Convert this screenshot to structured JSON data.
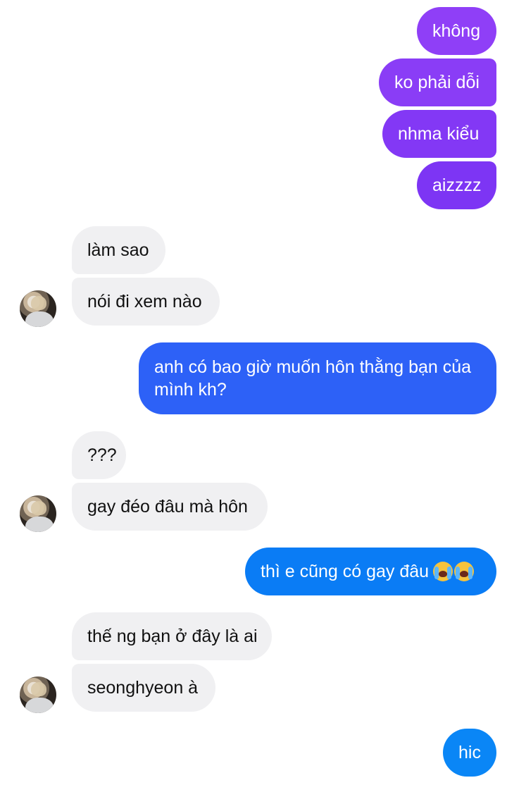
{
  "conversation": {
    "messages": [
      {
        "side": "out",
        "text": "không"
      },
      {
        "side": "out",
        "text": "ko phải dỗi"
      },
      {
        "side": "out",
        "text": "nhma kiểu"
      },
      {
        "side": "out",
        "text": "aizzzz"
      },
      {
        "side": "in",
        "text": "làm sao"
      },
      {
        "side": "in",
        "text": "nói đi xem nào"
      },
      {
        "side": "out",
        "text": "anh có bao giờ muốn hôn thằng bạn của mình kh?"
      },
      {
        "side": "in",
        "text": "???"
      },
      {
        "side": "in",
        "text": "gay đéo đâu mà hôn"
      },
      {
        "side": "out",
        "text": "thì e cũng có gay đâu"
      },
      {
        "side": "in",
        "text": "thế ng bạn ở đây là ai"
      },
      {
        "side": "in",
        "text": "seonghyeon à"
      },
      {
        "side": "out",
        "text": "hic"
      }
    ],
    "emoji": "😭😭"
  },
  "colors": {
    "outgoing_purple": "#8a3df6",
    "outgoing_blue": "#2d61f7",
    "outgoing_cyan_blue": "#0a7cf5",
    "incoming_bubble": "#f0f0f2"
  },
  "icons": {
    "avatar": "contact-avatar-icon",
    "emoji": "loudly-crying-face-icon"
  }
}
